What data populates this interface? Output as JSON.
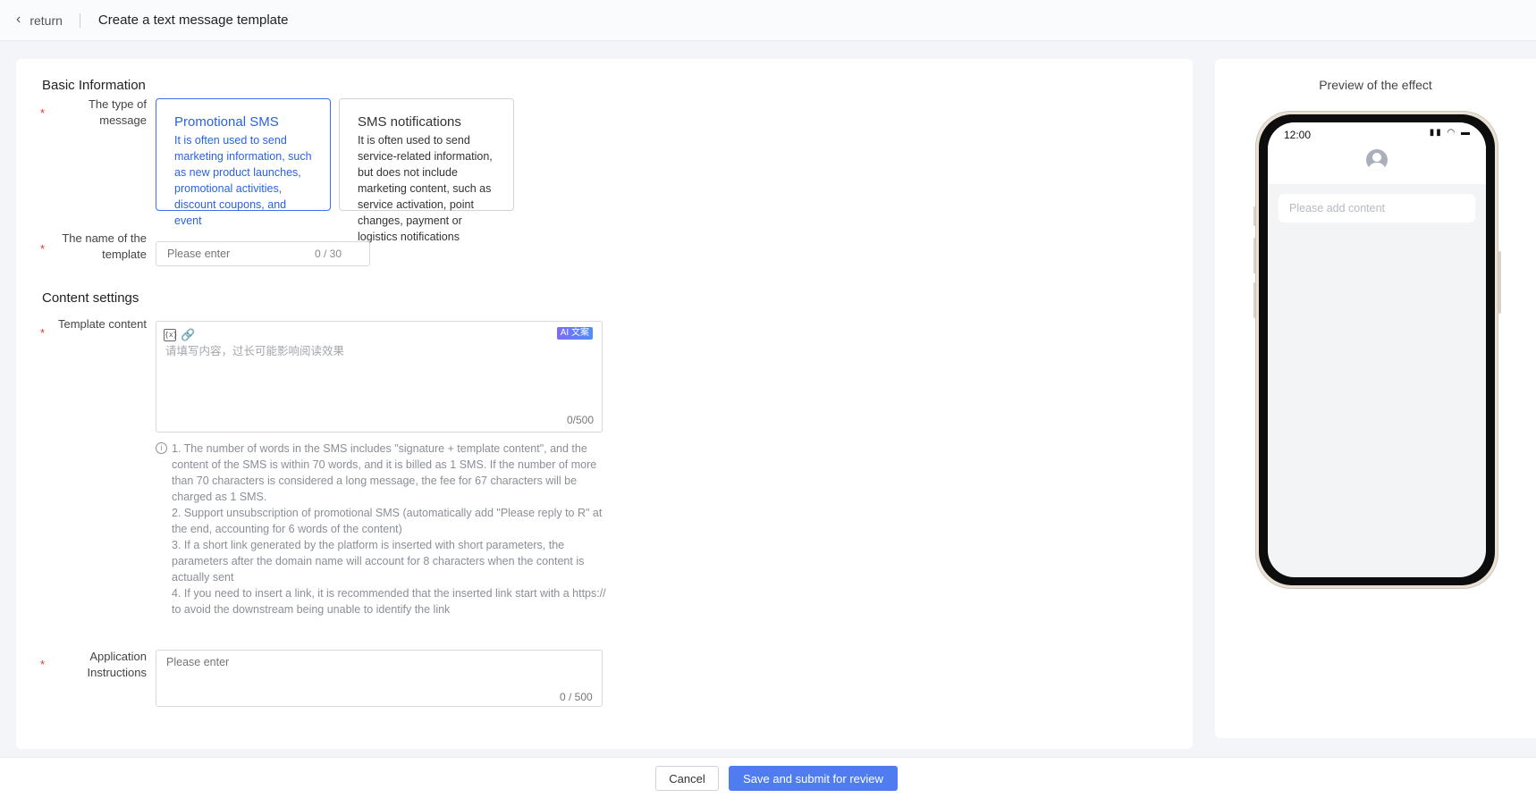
{
  "header": {
    "back_label": "return",
    "title": "Create a text message template"
  },
  "basic_info": {
    "section_title": "Basic Information",
    "type_label": "The type of message",
    "type_options": [
      {
        "title": "Promotional SMS",
        "desc": "It is often used to send marketing information, such as new product launches, promotional activities, discount coupons, and event",
        "selected": true
      },
      {
        "title": "SMS notifications",
        "desc": "It is often used to send service-related information, but does not include marketing content, such as service activation, point changes, payment or logistics notifications",
        "selected": false
      }
    ],
    "name_label": "The name of the template",
    "name_placeholder": "Please enter",
    "name_counter": "0 / 30"
  },
  "content_settings": {
    "section_title": "Content settings",
    "content_label": "Template content",
    "ai_badge": "AI 文案",
    "content_placeholder": "请填写内容，过长可能影响阅读效果",
    "content_counter": "0/500",
    "tips": [
      "1. The number of words in the SMS includes \"signature + template content\", and the content of the SMS is within 70 words, and it is billed as 1 SMS. If the number of more than 70 characters is considered a long message, the fee for 67 characters will be charged as 1 SMS.",
      "2. Support unsubscription of promotional SMS (automatically add \"Please reply to R\" at the end, accounting for 6 words of the content)",
      "3. If a short link generated by the platform is inserted with short parameters, the parameters after the domain name will account for 8 characters when the content is actually sent",
      "4. If you need to insert a link, it is recommended that the inserted link start with a https:// to avoid the downstream being unable to identify the link"
    ],
    "instructions_label": "Application Instructions",
    "instructions_placeholder": "Please enter",
    "instructions_counter": "0 / 500"
  },
  "preview": {
    "title": "Preview of the effect",
    "status_time": "12:00",
    "bubble_placeholder": "Please add content"
  },
  "footer": {
    "cancel_label": "Cancel",
    "submit_label": "Save and submit for review"
  }
}
